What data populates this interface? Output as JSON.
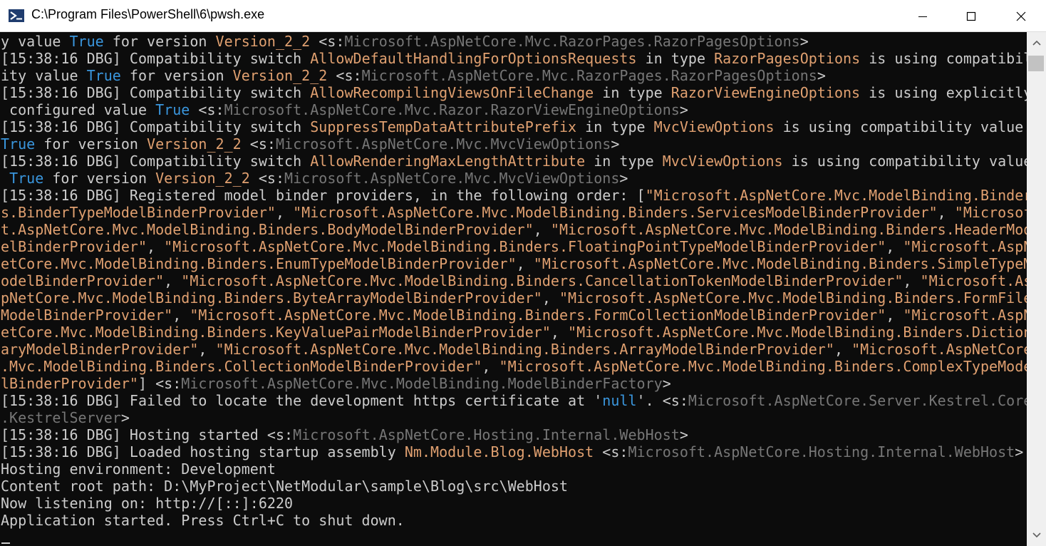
{
  "window": {
    "title": "C:\\Program Files\\PowerShell\\6\\pwsh.exe",
    "icon": "powershell-prompt-icon",
    "controls": [
      "minimize-icon",
      "maximize-icon",
      "close-icon"
    ]
  },
  "colors": {
    "background": "#0c0c0c",
    "text": "#cccccc",
    "string": "#e0a070",
    "boolean": "#3a96dd",
    "source": "#767676"
  },
  "console": {
    "lines": [
      [
        [
          "w",
          "y value "
        ],
        [
          "t",
          "True"
        ],
        [
          "w",
          " for version "
        ],
        [
          "o",
          "Version_2_2"
        ],
        [
          "w",
          " <s:"
        ],
        [
          "g",
          "Microsoft.AspNetCore.Mvc.RazorPages.RazorPagesOptions"
        ],
        [
          "w",
          ">"
        ]
      ],
      [
        [
          "w",
          "[15:38:16 DBG] Compatibility switch "
        ],
        [
          "o",
          "AllowDefaultHandlingForOptionsRequests"
        ],
        [
          "w",
          " in type "
        ],
        [
          "o",
          "RazorPagesOptions"
        ],
        [
          "w",
          " is using compatibil"
        ]
      ],
      [
        [
          "w",
          "ity value "
        ],
        [
          "t",
          "True"
        ],
        [
          "w",
          " for version "
        ],
        [
          "o",
          "Version_2_2"
        ],
        [
          "w",
          " <s:"
        ],
        [
          "g",
          "Microsoft.AspNetCore.Mvc.RazorPages.RazorPagesOptions"
        ],
        [
          "w",
          ">"
        ]
      ],
      [
        [
          "w",
          "[15:38:16 DBG] Compatibility switch "
        ],
        [
          "o",
          "AllowRecompilingViewsOnFileChange"
        ],
        [
          "w",
          " in type "
        ],
        [
          "o",
          "RazorViewEngineOptions"
        ],
        [
          "w",
          " is using explicitly"
        ]
      ],
      [
        [
          "w",
          " configured value "
        ],
        [
          "t",
          "True"
        ],
        [
          "w",
          " <s:"
        ],
        [
          "g",
          "Microsoft.AspNetCore.Mvc.Razor.RazorViewEngineOptions"
        ],
        [
          "w",
          ">"
        ]
      ],
      [
        [
          "w",
          "[15:38:16 DBG] Compatibility switch "
        ],
        [
          "o",
          "SuppressTempDataAttributePrefix"
        ],
        [
          "w",
          " in type "
        ],
        [
          "o",
          "MvcViewOptions"
        ],
        [
          "w",
          " is using compatibility value"
        ]
      ],
      [
        [
          "t",
          "True"
        ],
        [
          "w",
          " for version "
        ],
        [
          "o",
          "Version_2_2"
        ],
        [
          "w",
          " <s:"
        ],
        [
          "g",
          "Microsoft.AspNetCore.Mvc.MvcViewOptions"
        ],
        [
          "w",
          ">"
        ]
      ],
      [
        [
          "w",
          "[15:38:16 DBG] Compatibility switch "
        ],
        [
          "o",
          "AllowRenderingMaxLengthAttribute"
        ],
        [
          "w",
          " in type "
        ],
        [
          "o",
          "MvcViewOptions"
        ],
        [
          "w",
          " is using compatibility value"
        ]
      ],
      [
        [
          "w",
          " "
        ],
        [
          "t",
          "True"
        ],
        [
          "w",
          " for version "
        ],
        [
          "o",
          "Version_2_2"
        ],
        [
          "w",
          " <s:"
        ],
        [
          "g",
          "Microsoft.AspNetCore.Mvc.MvcViewOptions"
        ],
        [
          "w",
          ">"
        ]
      ],
      [
        [
          "w",
          "[15:38:16 DBG] Registered model binder providers, in the following order: ["
        ],
        [
          "o",
          "\"Microsoft.AspNetCore.Mvc.ModelBinding.Binder"
        ]
      ],
      [
        [
          "o",
          "s.BinderTypeModelBinderProvider\""
        ],
        [
          "w",
          ", "
        ],
        [
          "o",
          "\"Microsoft.AspNetCore.Mvc.ModelBinding.Binders.ServicesModelBinderProvider\""
        ],
        [
          "w",
          ", "
        ],
        [
          "o",
          "\"Microsof"
        ]
      ],
      [
        [
          "o",
          "t.AspNetCore.Mvc.ModelBinding.Binders.BodyModelBinderProvider\""
        ],
        [
          "w",
          ", "
        ],
        [
          "o",
          "\"Microsoft.AspNetCore.Mvc.ModelBinding.Binders.HeaderMod"
        ]
      ],
      [
        [
          "o",
          "elBinderProvider\""
        ],
        [
          "w",
          ", "
        ],
        [
          "o",
          "\"Microsoft.AspNetCore.Mvc.ModelBinding.Binders.FloatingPointTypeModelBinderProvider\""
        ],
        [
          "w",
          ", "
        ],
        [
          "o",
          "\"Microsoft.AspN"
        ]
      ],
      [
        [
          "o",
          "etCore.Mvc.ModelBinding.Binders.EnumTypeModelBinderProvider\""
        ],
        [
          "w",
          ", "
        ],
        [
          "o",
          "\"Microsoft.AspNetCore.Mvc.ModelBinding.Binders.SimpleTypeM"
        ]
      ],
      [
        [
          "o",
          "odelBinderProvider\""
        ],
        [
          "w",
          ", "
        ],
        [
          "o",
          "\"Microsoft.AspNetCore.Mvc.ModelBinding.Binders.CancellationTokenModelBinderProvider\""
        ],
        [
          "w",
          ", "
        ],
        [
          "o",
          "\"Microsoft.As"
        ]
      ],
      [
        [
          "o",
          "pNetCore.Mvc.ModelBinding.Binders.ByteArrayModelBinderProvider\""
        ],
        [
          "w",
          ", "
        ],
        [
          "o",
          "\"Microsoft.AspNetCore.Mvc.ModelBinding.Binders.FormFile"
        ]
      ],
      [
        [
          "o",
          "ModelBinderProvider\""
        ],
        [
          "w",
          ", "
        ],
        [
          "o",
          "\"Microsoft.AspNetCore.Mvc.ModelBinding.Binders.FormCollectionModelBinderProvider\""
        ],
        [
          "w",
          ", "
        ],
        [
          "o",
          "\"Microsoft.AspN"
        ]
      ],
      [
        [
          "o",
          "etCore.Mvc.ModelBinding.Binders.KeyValuePairModelBinderProvider\""
        ],
        [
          "w",
          ", "
        ],
        [
          "o",
          "\"Microsoft.AspNetCore.Mvc.ModelBinding.Binders.Diction"
        ]
      ],
      [
        [
          "o",
          "aryModelBinderProvider\""
        ],
        [
          "w",
          ", "
        ],
        [
          "o",
          "\"Microsoft.AspNetCore.Mvc.ModelBinding.Binders.ArrayModelBinderProvider\""
        ],
        [
          "w",
          ", "
        ],
        [
          "o",
          "\"Microsoft.AspNetCore"
        ]
      ],
      [
        [
          "o",
          ".Mvc.ModelBinding.Binders.CollectionModelBinderProvider\""
        ],
        [
          "w",
          ", "
        ],
        [
          "o",
          "\"Microsoft.AspNetCore.Mvc.ModelBinding.Binders.ComplexTypeMode"
        ]
      ],
      [
        [
          "o",
          "lBinderProvider\""
        ],
        [
          "w",
          "] <s:"
        ],
        [
          "g",
          "Microsoft.AspNetCore.Mvc.ModelBinding.ModelBinderFactory"
        ],
        [
          "w",
          ">"
        ]
      ],
      [
        [
          "w",
          "[15:38:16 DBG] Failed to locate the development https certificate at '"
        ],
        [
          "t",
          "null"
        ],
        [
          "w",
          "'. <s:"
        ],
        [
          "g",
          "Microsoft.AspNetCore.Server.Kestrel.Core"
        ]
      ],
      [
        [
          "g",
          ".KestrelServer"
        ],
        [
          "w",
          ">"
        ]
      ],
      [
        [
          "w",
          "[15:38:16 DBG] Hosting started <s:"
        ],
        [
          "g",
          "Microsoft.AspNetCore.Hosting.Internal.WebHost"
        ],
        [
          "w",
          ">"
        ]
      ],
      [
        [
          "w",
          "[15:38:16 DBG] Loaded hosting startup assembly "
        ],
        [
          "o",
          "Nm.Module.Blog.WebHost"
        ],
        [
          "w",
          " <s:"
        ],
        [
          "g",
          "Microsoft.AspNetCore.Hosting.Internal.WebHost"
        ],
        [
          "w",
          ">"
        ]
      ],
      [
        [
          "w",
          "Hosting environment: Development"
        ]
      ],
      [
        [
          "w",
          "Content root path: D:\\MyProject\\NetModular\\sample\\Blog\\src\\WebHost"
        ]
      ],
      [
        [
          "w",
          "Now listening on: http://[::]:6220"
        ]
      ],
      [
        [
          "w",
          "Application started. Press Ctrl+C to shut down."
        ]
      ]
    ]
  }
}
